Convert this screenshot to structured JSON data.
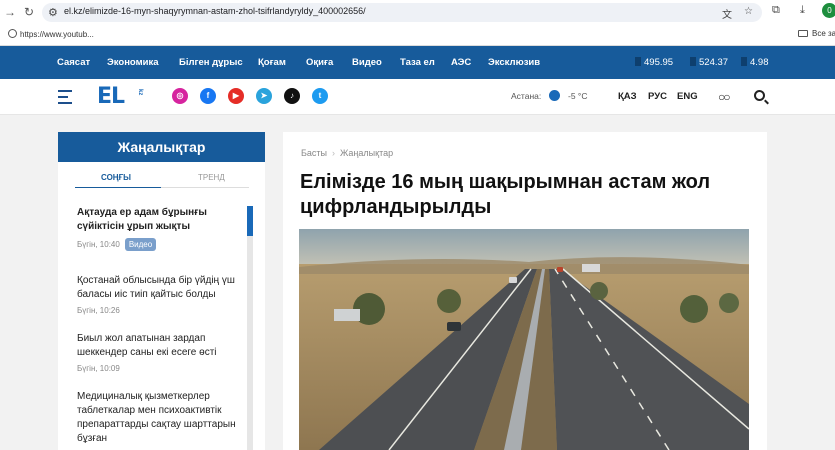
{
  "browser": {
    "url": "el.kz/elimizde-16-myn-shaqyrymnan-astam-zhol-tsifrlandyryldy_400002656/",
    "bookmark": "https://www.youtub...",
    "all_bookmarks": "Все за",
    "profile_letter": "0"
  },
  "topnav": {
    "items": [
      "Саясат",
      "Экономика",
      "Білген дұрыс",
      "Қоғам",
      "Оқиға",
      "Видео",
      "Таза ел",
      "АЭС",
      "Эксклюзив"
    ],
    "rates": [
      "495.95",
      "524.37",
      "4.98"
    ]
  },
  "header": {
    "logo": "EL",
    "logo_suffix": "kz",
    "social_icons": [
      "instagram-icon",
      "facebook-icon",
      "youtube-icon",
      "telegram-icon",
      "tiktok-icon",
      "twitter-icon"
    ],
    "weather_city": "Астана:",
    "weather_temp": "-5 °C",
    "languages": [
      "ҚАЗ",
      "РУС",
      "ENG"
    ]
  },
  "sidebar": {
    "title": "Жаңалықтар",
    "tabs": [
      "Соңғы",
      "Тренд"
    ],
    "news": [
      {
        "title": "Ақтауда ер адам бұрынғы сүйіктісін ұрып жықты",
        "time": "Бүгін, 10:40",
        "badge": "Видео"
      },
      {
        "title": "Қостанай облысында бір үйдің үш баласы иіс тиіп қайтыс болды",
        "time": "Бүгін, 10:26"
      },
      {
        "title": "Биыл жол апатынан зардап шеккендер саны екі есеге өсті",
        "time": "Бүгін, 10:09"
      },
      {
        "title": "Медициналық қызметкерлер таблеткалар мен психоактивтік препараттарды сақтау шарттарын бұзған",
        "time": ""
      }
    ]
  },
  "article": {
    "breadcrumb": [
      "Басты",
      "Жаңалықтар"
    ],
    "headline": "Елімізде 16 мың шақырымнан астам жол цифрландырылды"
  },
  "colors": {
    "brand_blue": "#175b9b",
    "logo_blue": "#1969b8"
  }
}
